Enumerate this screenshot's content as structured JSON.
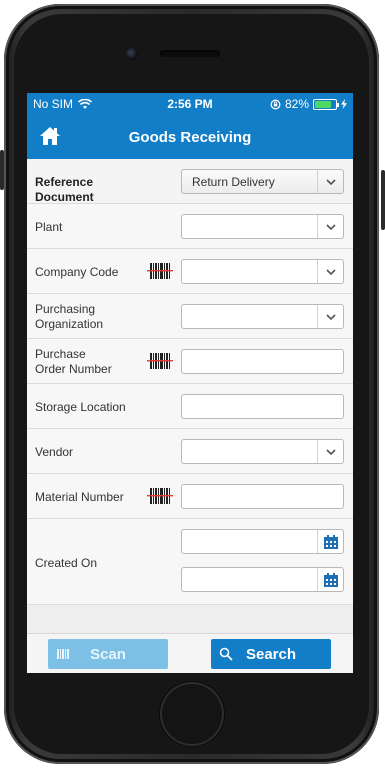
{
  "status_bar": {
    "carrier": "No SIM",
    "time": "2:56 PM",
    "battery": "82%"
  },
  "nav": {
    "title": "Goods Receiving"
  },
  "fields": {
    "reference_document": {
      "label": "Reference Document",
      "value": "Return Delivery"
    },
    "plant": {
      "label": "Plant",
      "value": ""
    },
    "company_code": {
      "label": "Company Code",
      "value": ""
    },
    "purchasing_organization": {
      "label_line1": "Purchasing",
      "label_line2": "Organization",
      "value": ""
    },
    "purchase_order_number": {
      "label_line1": "Purchase",
      "label_line2": "Order Number",
      "value": ""
    },
    "storage_location": {
      "label": "Storage Location",
      "value": ""
    },
    "vendor": {
      "label": "Vendor",
      "value": ""
    },
    "material_number": {
      "label": "Material Number",
      "value": ""
    },
    "created_on": {
      "label": "Created On",
      "from": "",
      "to": ""
    }
  },
  "buttons": {
    "scan": "Scan",
    "search": "Search"
  },
  "colors": {
    "brand_blue": "#137ec8",
    "scan_disabled": "#7cc0e6"
  },
  "icons": [
    "home-icon",
    "wifi-icon",
    "lock-rotation-icon",
    "battery-icon",
    "chevron-down-icon",
    "barcode-icon",
    "calendar-icon",
    "scan-icon",
    "search-icon"
  ]
}
